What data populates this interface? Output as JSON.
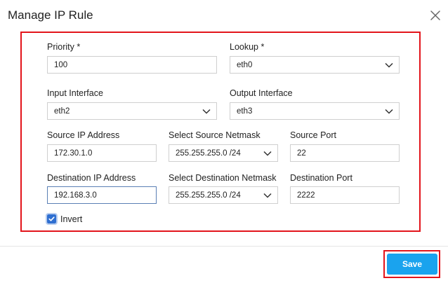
{
  "dialog": {
    "title": "Manage IP Rule"
  },
  "form": {
    "priority": {
      "label": "Priority *",
      "value": "100"
    },
    "lookup": {
      "label": "Lookup *",
      "value": "eth0"
    },
    "input_interface": {
      "label": "Input Interface",
      "value": "eth2"
    },
    "output_interface": {
      "label": "Output Interface",
      "value": "eth3"
    },
    "source_ip": {
      "label": "Source IP Address",
      "value": "172.30.1.0"
    },
    "source_netmask": {
      "label": "Select Source Netmask",
      "value": "255.255.255.0 /24"
    },
    "source_port": {
      "label": "Source Port",
      "value": "22"
    },
    "destination_ip": {
      "label": "Destination IP Address",
      "value": "192.168.3.0"
    },
    "destination_netmask": {
      "label": "Select Destination Netmask",
      "value": "255.255.255.0 /24"
    },
    "destination_port": {
      "label": "Destination Port",
      "value": "2222"
    },
    "invert": {
      "label": "Invert",
      "checked": true
    }
  },
  "footer": {
    "save_label": "Save"
  },
  "colors": {
    "highlight": "#e3141b",
    "primary_button": "#1aa3ee",
    "checkbox": "#2f6fd1"
  },
  "icons": {
    "close": "close-icon",
    "dropdown": "chevron-down-icon",
    "check": "check-icon"
  }
}
